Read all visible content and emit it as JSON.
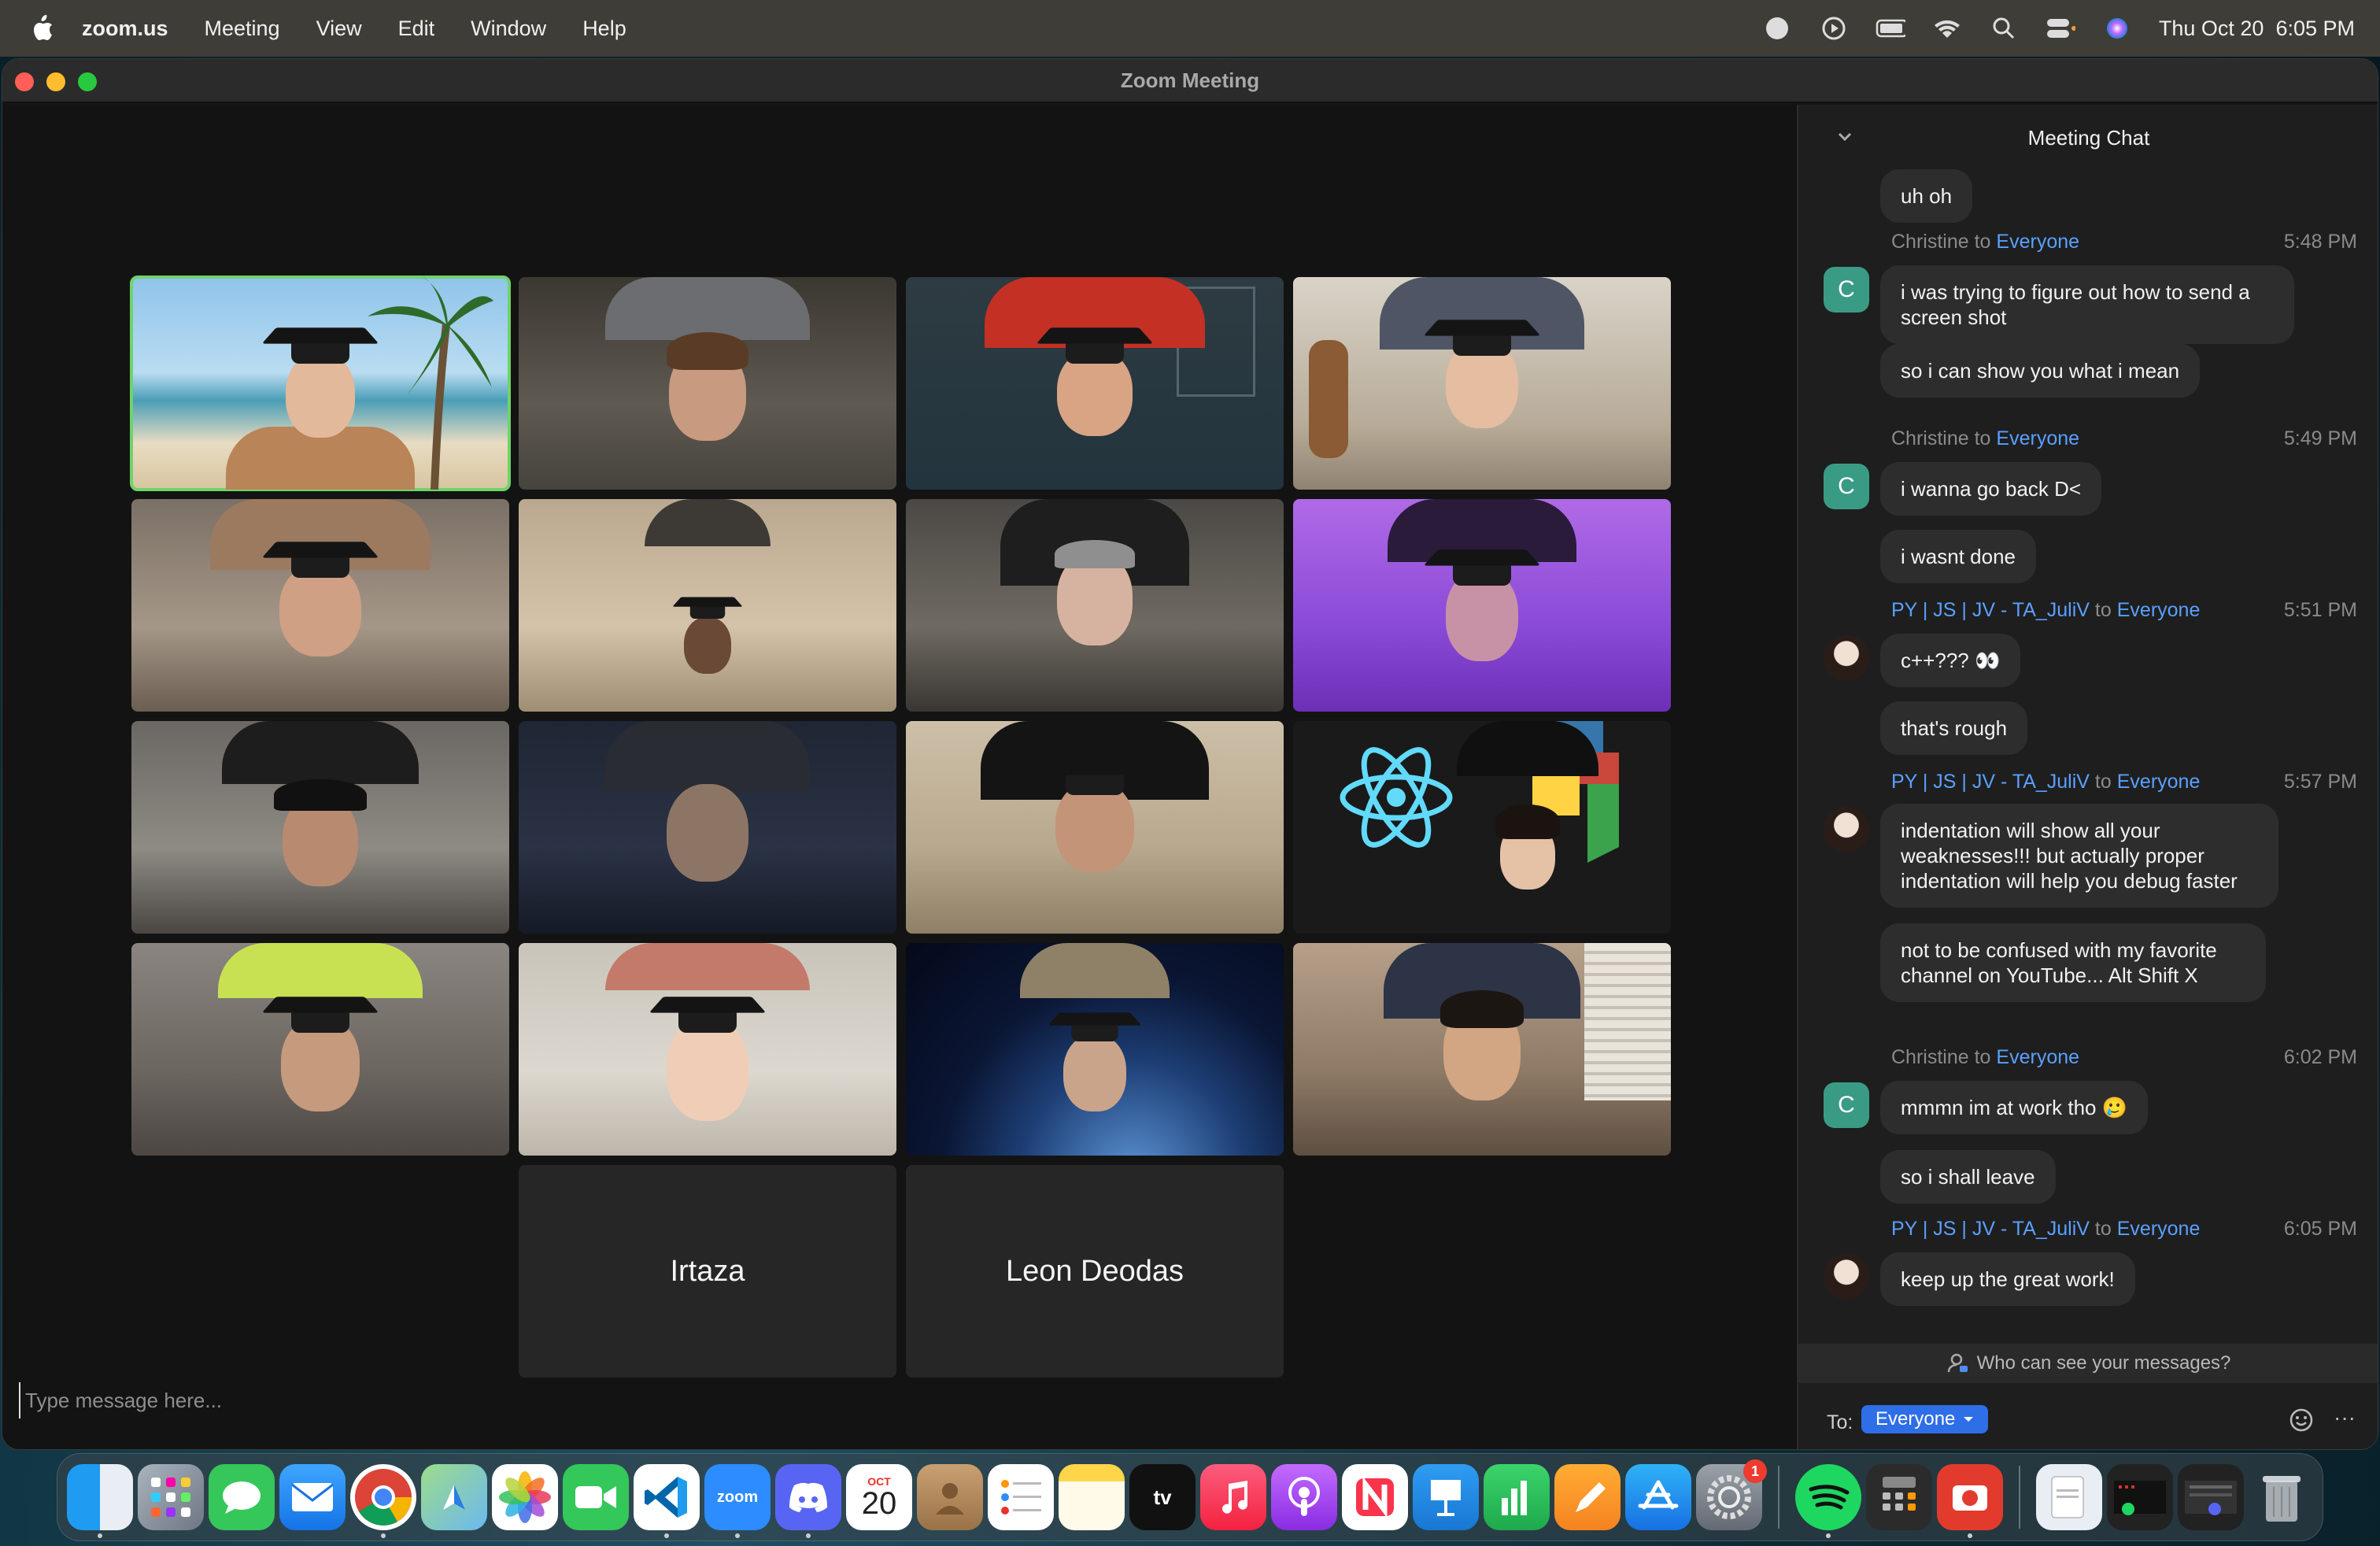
{
  "menubar": {
    "app_name": "zoom.us",
    "items": [
      "Meeting",
      "View",
      "Edit",
      "Window",
      "Help"
    ],
    "clock": "Thu Oct 20  6:05 PM"
  },
  "window": {
    "title": "Zoom Meeting"
  },
  "participants": {
    "name_tiles": [
      "Irtaza",
      "Leon Deodas"
    ]
  },
  "chat": {
    "header": "Meeting Chat",
    "to_word": "to",
    "messages": [
      {
        "text": "uh oh"
      },
      {
        "sender": "Christine",
        "to": "Everyone",
        "time": "5:48 PM",
        "avatar": "C"
      },
      {
        "text": "i was trying to figure out how to send a screen shot"
      },
      {
        "text": "so i can show you what i mean"
      },
      {
        "sender": "Christine",
        "to": "Everyone",
        "time": "5:49 PM",
        "avatar": "C"
      },
      {
        "text": "i wanna go back D<"
      },
      {
        "text": "i wasnt done"
      },
      {
        "sender": "PY | JS | JV - TA_JuliV",
        "to": "Everyone",
        "time": "5:51 PM"
      },
      {
        "text": "c++??? 👀"
      },
      {
        "text": "that's rough"
      },
      {
        "sender": "PY | JS | JV - TA_JuliV",
        "to": "Everyone",
        "time": "5:57 PM"
      },
      {
        "text": "indentation will show all your weaknesses!!! but actually proper indentation will help you debug faster"
      },
      {
        "text": "not to be confused with my favorite channel on YouTube... Alt Shift X"
      },
      {
        "sender": "Christine",
        "to": "Everyone",
        "time": "6:02 PM",
        "avatar": "C"
      },
      {
        "text": "mmmn im at work tho 🥲"
      },
      {
        "text": "so i shall leave"
      },
      {
        "sender": "PY | JS | JV - TA_JuliV",
        "to": "Everyone",
        "time": "6:05 PM"
      },
      {
        "text": "keep up the great work!"
      }
    ],
    "who_can_see": "Who can see your messages?",
    "to_label": "To:",
    "recipient": "Everyone",
    "input_placeholder": "Type message here..."
  },
  "dock": {
    "calendar_month": "OCT",
    "calendar_day": "20",
    "zoom_label": "zoom",
    "tv_label": "tv",
    "settings_badge": "1"
  }
}
